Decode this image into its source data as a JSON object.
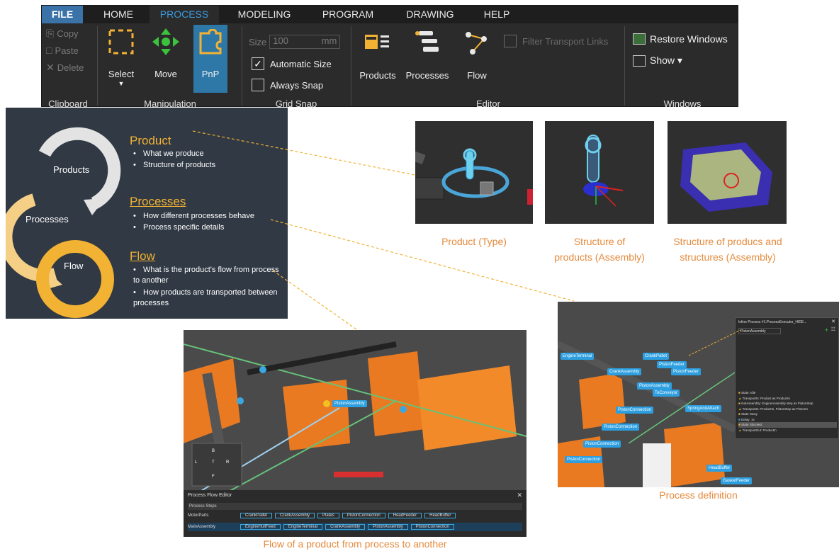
{
  "ribbon": {
    "tabs": [
      "FILE",
      "HOME",
      "PROCESS",
      "MODELING",
      "PROGRAM",
      "DRAWING",
      "HELP"
    ],
    "active_tab": "PROCESS",
    "clipboard": {
      "copy": "Copy",
      "paste": "Paste",
      "delete": "Delete",
      "label": "Clipboard"
    },
    "manipulation": {
      "select": "Select",
      "move": "Move",
      "pnp": "PnP",
      "label": "Manipulation"
    },
    "grid_snap": {
      "size_label": "Size",
      "size_value": "100",
      "unit": "mm",
      "automatic_size": "Automatic Size",
      "always_snap": "Always Snap",
      "label": "Grid Snap"
    },
    "editor": {
      "products": "Products",
      "processes": "Processes",
      "flow": "Flow",
      "filter_transport": "Filter Transport Links",
      "label": "Editor"
    },
    "windows": {
      "restore": "Restore Windows",
      "show": "Show ▾",
      "label": "Windows"
    },
    "colors": {
      "file_tab": "#3b73a8",
      "active_tab": "#3b9be0",
      "pnp_button": "#2e78a8",
      "move_icon": "#3cc23c",
      "select_icon": "#f2b233"
    }
  },
  "concept": {
    "cycle": [
      "Products",
      "Processes",
      "Flow"
    ],
    "product": {
      "title": "Product",
      "bullets": [
        "What we produce",
        "Structure of products"
      ]
    },
    "processes": {
      "title": "Processes",
      "bullets": [
        "How different processes behave",
        "Process specific details"
      ]
    },
    "flow": {
      "title": "Flow",
      "bullets": [
        "What is the product's flow from process to another",
        "How products are transported between processes"
      ]
    }
  },
  "captions": {
    "product_type": "Product (Type)",
    "structure_1": "Structure of products (Assembly)",
    "structure_2": "Structure of producs and structures (Assembly)",
    "process_definition": "Process definition",
    "flow_caption": "Flow of a product from process to another"
  },
  "flow_editor": {
    "title": "Process Flow Editor",
    "process_steps": "Process Steps",
    "rows": [
      {
        "name": "MotorParts",
        "steps": [
          "CrankPallet",
          "CrankAssembly",
          "Plates",
          "PistonConnection",
          "HeadFeeder",
          "HeadBuffer"
        ]
      },
      {
        "name": "MainAssembly",
        "steps": [
          "EngineHullFeed",
          "EngineTerminal",
          "CrankAssembly",
          "PistonAssembly",
          "PistonConnection"
        ]
      }
    ],
    "scene_label": "PistonAssembly",
    "viewcube": [
      "B",
      "L",
      "T",
      "R",
      "F"
    ]
  },
  "process_panel": {
    "title": "Inline Process #1:ProcessExecutor_HIDE...",
    "dropdown": "PistonAssembly",
    "items": [
      "State: Idle",
      "TransportIn: Product as ProductIn",
      "GetAssembly: EngineAssembly step as PistonStep",
      "TransportIn: ProductIn, PistonStep as PistonIn",
      "State: Busy",
      "Delay: 1s",
      "State: Blocked",
      "TransportOut: ProductIn"
    ],
    "scene_labels": [
      "EngineTerminal",
      "CrankAssembly",
      "CrankPallet",
      "PistonFeeder",
      "PistonFeeder",
      "PistonAssembly",
      "ToConveyor",
      "PistonConnection",
      "SpringAndAttach",
      "PistonConnection",
      "PistonConnection",
      "PistonConnection",
      "HeadBuffer",
      "GasketFeeder"
    ]
  }
}
